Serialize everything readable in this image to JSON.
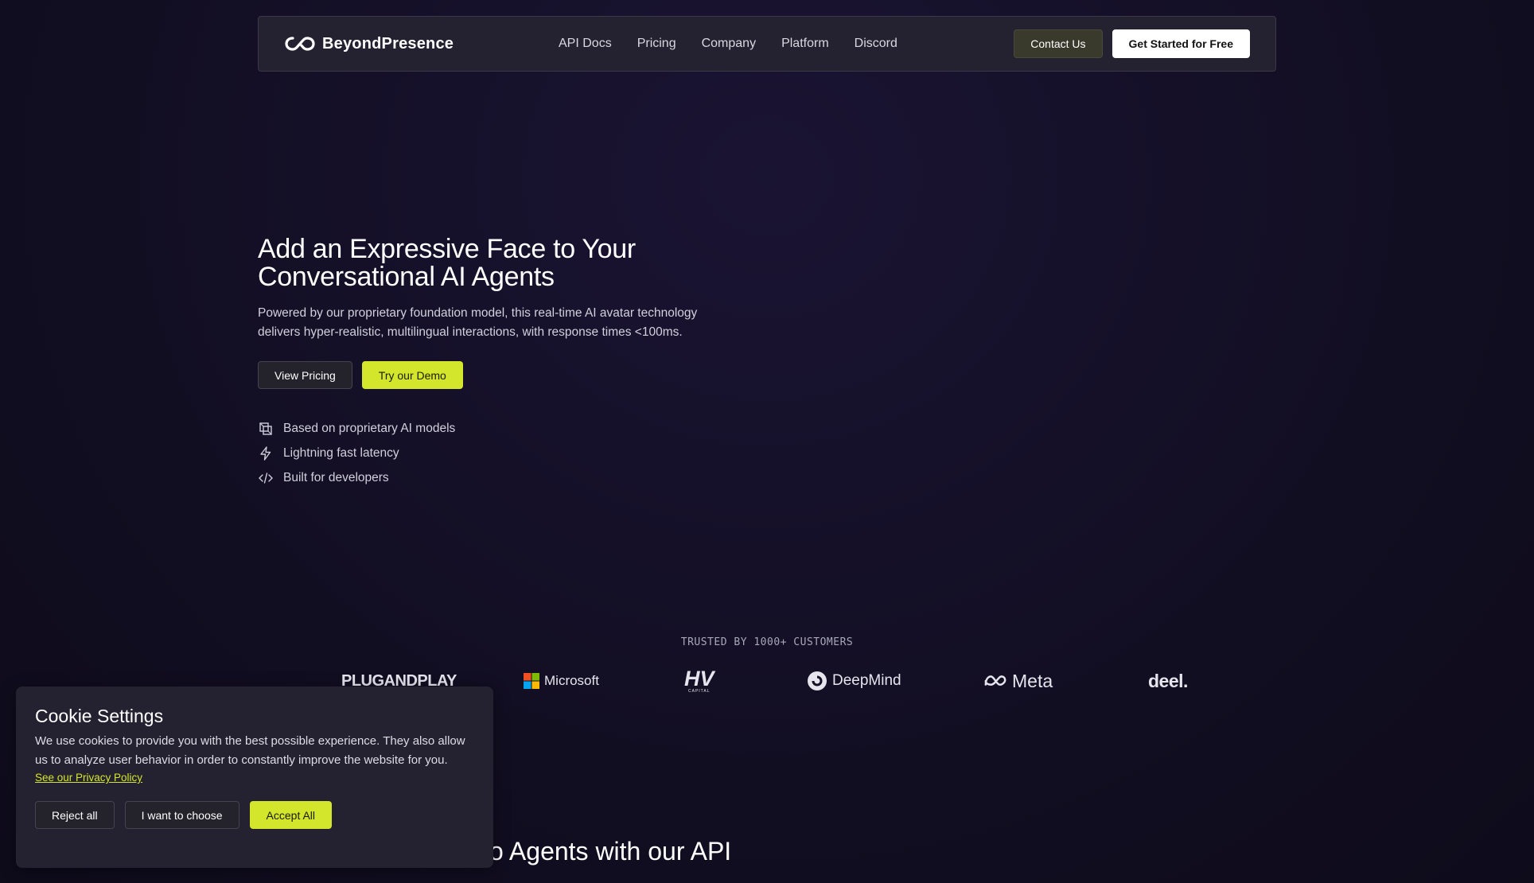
{
  "nav": {
    "brand": "BeyondPresence",
    "links": [
      "API Docs",
      "Pricing",
      "Company",
      "Platform",
      "Discord"
    ],
    "contact_label": "Contact Us",
    "cta_label": "Get Started for Free"
  },
  "hero": {
    "title_line1": "Add an Expressive Face to Your",
    "title_line2": "Conversational AI Agents",
    "subtitle": "Powered by our proprietary foundation model, this real-time AI avatar technology delivers hyper-realistic, multilingual interactions, with response times <100ms.",
    "view_pricing_label": "View Pricing",
    "demo_label": "Try our Demo",
    "features": [
      {
        "icon": "model-icon",
        "label": "Based on proprietary AI models"
      },
      {
        "icon": "lightning-icon",
        "label": "Lightning fast latency"
      },
      {
        "icon": "code-icon",
        "label": "Built for developers"
      }
    ]
  },
  "trusted": {
    "label": "TRUSTED BY 1000+ CUSTOMERS",
    "logos": [
      "PLUGANDPLAY",
      "Microsoft",
      "HV",
      "DeepMind",
      "Meta",
      "deel."
    ],
    "hv_small": "CAPITAL"
  },
  "section": {
    "title_visible": "o Agents with our API"
  },
  "cookie": {
    "title": "Cookie Settings",
    "text": "We use cookies to provide you with the best possible experience. They also allow us to analyze user behavior in order to constantly improve the website for you.",
    "link": "See our Privacy Policy",
    "reject_label": "Reject all",
    "choose_label": "I want to choose",
    "accept_label": "Accept All"
  },
  "colors": {
    "accent": "#d3e62c",
    "background": "#130f24",
    "panel": "#242230"
  }
}
